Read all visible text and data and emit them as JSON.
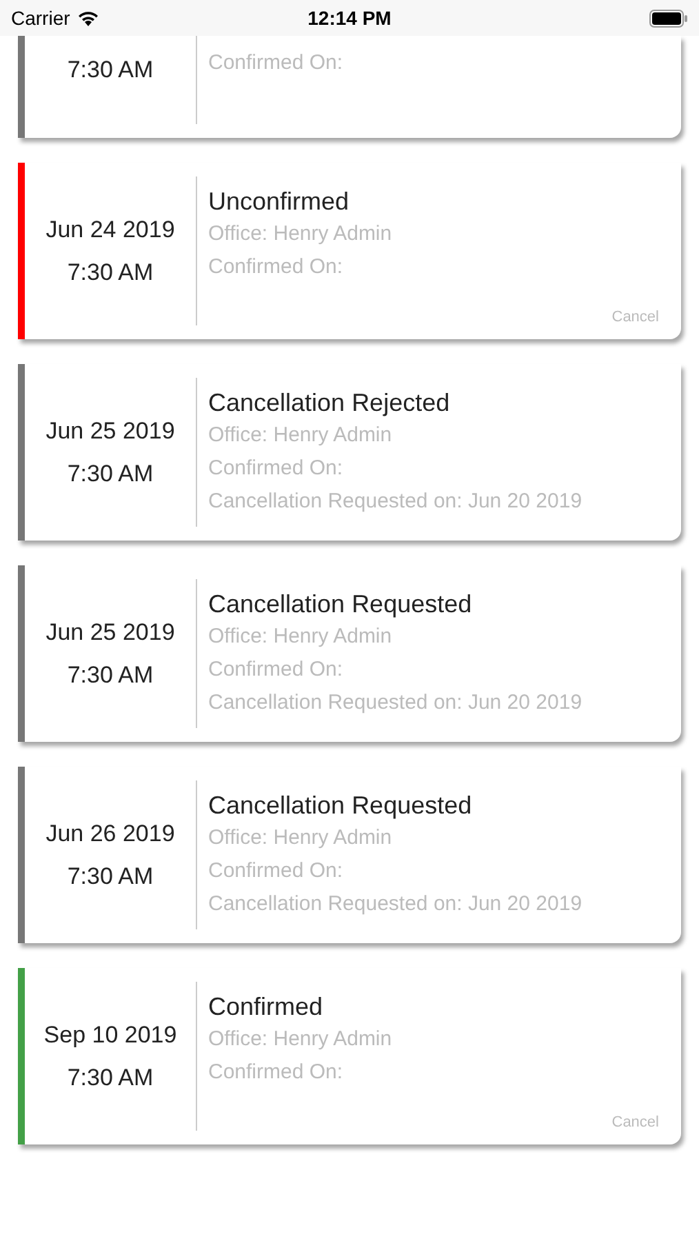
{
  "status_bar": {
    "carrier": "Carrier",
    "time": "12:14 PM"
  },
  "appointments": [
    {
      "kind": "clipped",
      "time": "7:30 AM",
      "confirmed_on": "Confirmed On:",
      "color": "#777777"
    },
    {
      "date": "Jun 24 2019",
      "time": "7:30 AM",
      "status": "Unconfirmed",
      "office": "Office: Henry Admin",
      "confirmed_on": "Confirmed On:",
      "cancel": "Cancel",
      "color": "#ff0000"
    },
    {
      "date": "Jun 25 2019",
      "time": "7:30 AM",
      "status": "Cancellation Rejected",
      "office": "Office: Henry Admin",
      "confirmed_on": "Confirmed On:",
      "cancellation_requested": "Cancellation Requested on: Jun 20 2019",
      "color": "#777777"
    },
    {
      "date": "Jun 25 2019",
      "time": "7:30 AM",
      "status": "Cancellation Requested",
      "office": "Office: Henry Admin",
      "confirmed_on": "Confirmed On:",
      "cancellation_requested": "Cancellation Requested on: Jun 20 2019",
      "color": "#777777"
    },
    {
      "date": "Jun 26 2019",
      "time": "7:30 AM",
      "status": "Cancellation Requested",
      "office": "Office: Henry Admin",
      "confirmed_on": "Confirmed On:",
      "cancellation_requested": "Cancellation Requested on: Jun 20 2019",
      "color": "#777777"
    },
    {
      "date": "Sep 10 2019",
      "time": "7:30 AM",
      "status": "Confirmed",
      "office": "Office: Henry Admin",
      "confirmed_on": "Confirmed On:",
      "cancel": "Cancel",
      "color": "#43a047"
    }
  ]
}
